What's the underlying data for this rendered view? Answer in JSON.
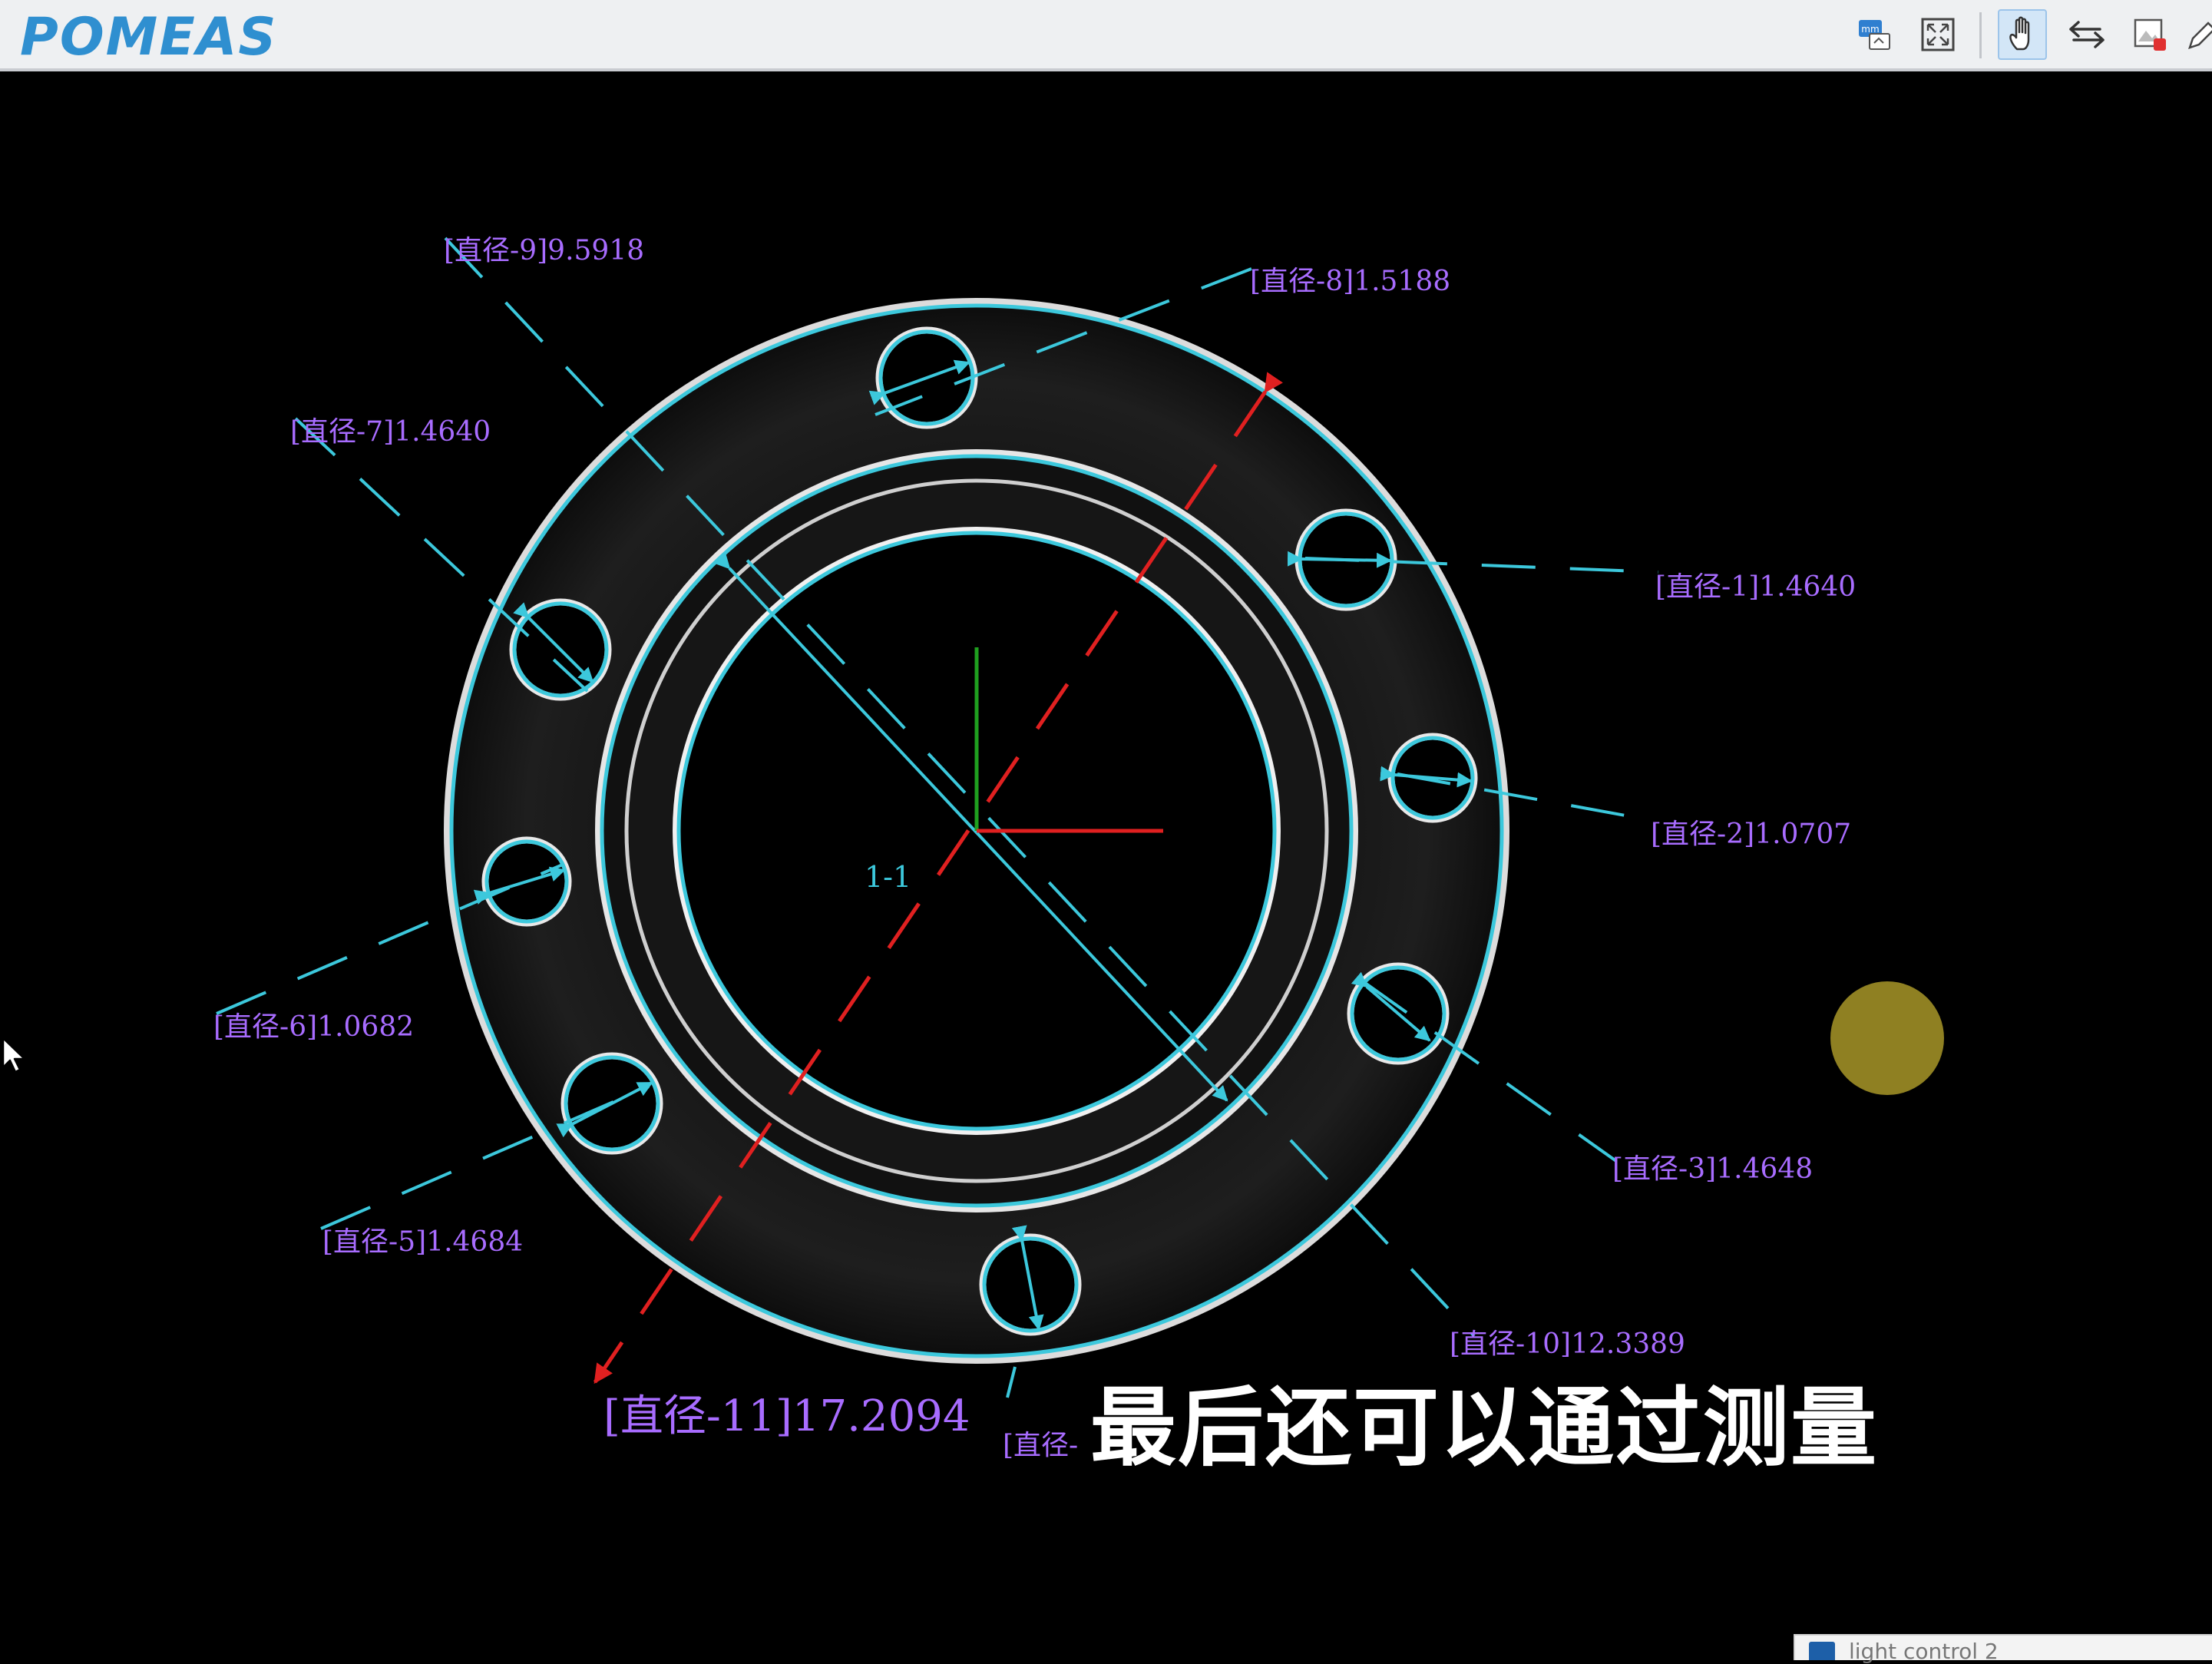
{
  "app": {
    "logo_text": "POMEAS"
  },
  "toolbar": {
    "buttons": [
      {
        "name": "unit-mm-button",
        "icon": "mm-unit-icon",
        "active": false
      },
      {
        "name": "fit-screen-button",
        "icon": "fit-screen-icon",
        "active": false
      },
      {
        "name": "pan-hand-button",
        "icon": "hand-icon",
        "active": true
      },
      {
        "name": "swap-button",
        "icon": "swap-arrows-icon",
        "active": false
      },
      {
        "name": "image-export-button",
        "icon": "image-red-dot-icon",
        "active": false
      },
      {
        "name": "edit-button",
        "icon": "pencil-icon",
        "active": false
      }
    ]
  },
  "measurements": {
    "d1": "[直径-1]1.4640",
    "d2": "[直径-2]1.0707",
    "d3": "[直径-3]1.4648",
    "d5": "[直径-5]1.4684",
    "d6": "[直径-6]1.0682",
    "d7": "[直径-7]1.4640",
    "d8": "[直径-8]1.5188",
    "d9": "[直径-9]9.5918",
    "d10": "[直径-10]12.3389",
    "d11": "[直径-11]17.2094",
    "d12_partial": "[直径-"
  },
  "center_label": "1-1",
  "subtitle": "最后还可以通过测量",
  "taskbar": {
    "peek_text": "light control 2"
  },
  "colors": {
    "measure_line": "#3cc8dc",
    "measure_text": "#a86cff",
    "axis_x": "#e02020",
    "axis_y": "#1fa01f",
    "diag_dash": "#e02020",
    "toolbar_bg": "#eef0f2",
    "logo": "#2f8fd0"
  }
}
